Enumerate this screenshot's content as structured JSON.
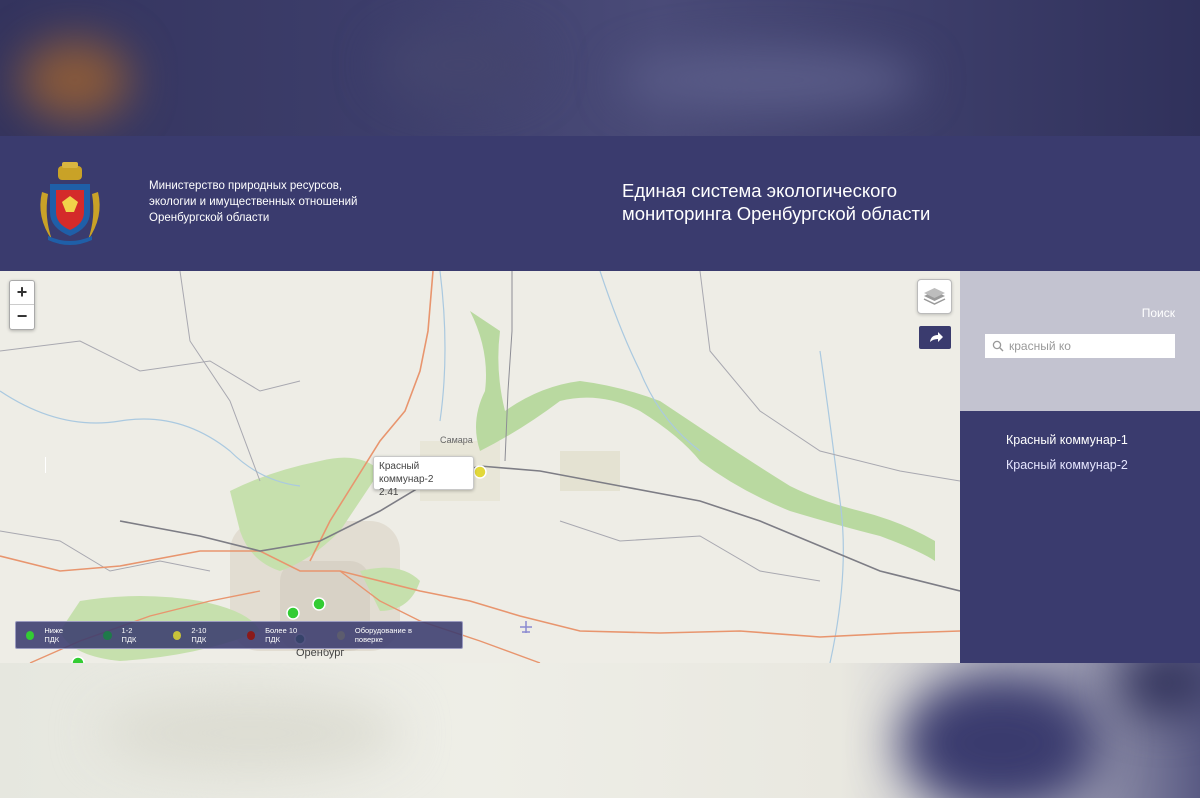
{
  "header": {
    "ministry_lines": [
      "Министерство природных ресурсов,",
      "экологии и имущественных отношений",
      "Оренбургской области"
    ],
    "system_title_lines": [
      "Единая система экологического",
      "мониторинга Оренбургской области"
    ],
    "crest_icon": "coat-of-arms-icon"
  },
  "map": {
    "zoom_in": "+",
    "zoom_out": "−",
    "layers_icon": "layers-icon",
    "share_icon": "share-arrow-icon",
    "tooltip": {
      "name": "Красный коммунар-2",
      "value": "2.41"
    },
    "city_label": "Оренбург",
    "partial_labels": [
      "Самара"
    ],
    "legend": [
      {
        "label": "Ниже ПДК",
        "color": "#33cc33"
      },
      {
        "label": "1-2 ПДК",
        "color": "#1f7a4a"
      },
      {
        "label": "2-10 ПДК",
        "color": "#c8c23a"
      },
      {
        "label": "Более 10 ПДК",
        "color": "#8b1a1a"
      },
      {
        "label": "Оборудование в поверке",
        "color": "#5c5c6e"
      }
    ],
    "colors": {
      "station_green": "#33cc33",
      "station_yellow": "#e2d83a",
      "forest": "#b9d9a0"
    }
  },
  "sidebar": {
    "search_label": "Поиск",
    "search_value": "красный ко",
    "search_icon": "search-icon",
    "results": [
      "Красный коммунар-1",
      "Красный коммунар-2"
    ]
  },
  "colors": {
    "brand": "#3a3b6e",
    "sidebar_light": "#c3c3d0"
  }
}
